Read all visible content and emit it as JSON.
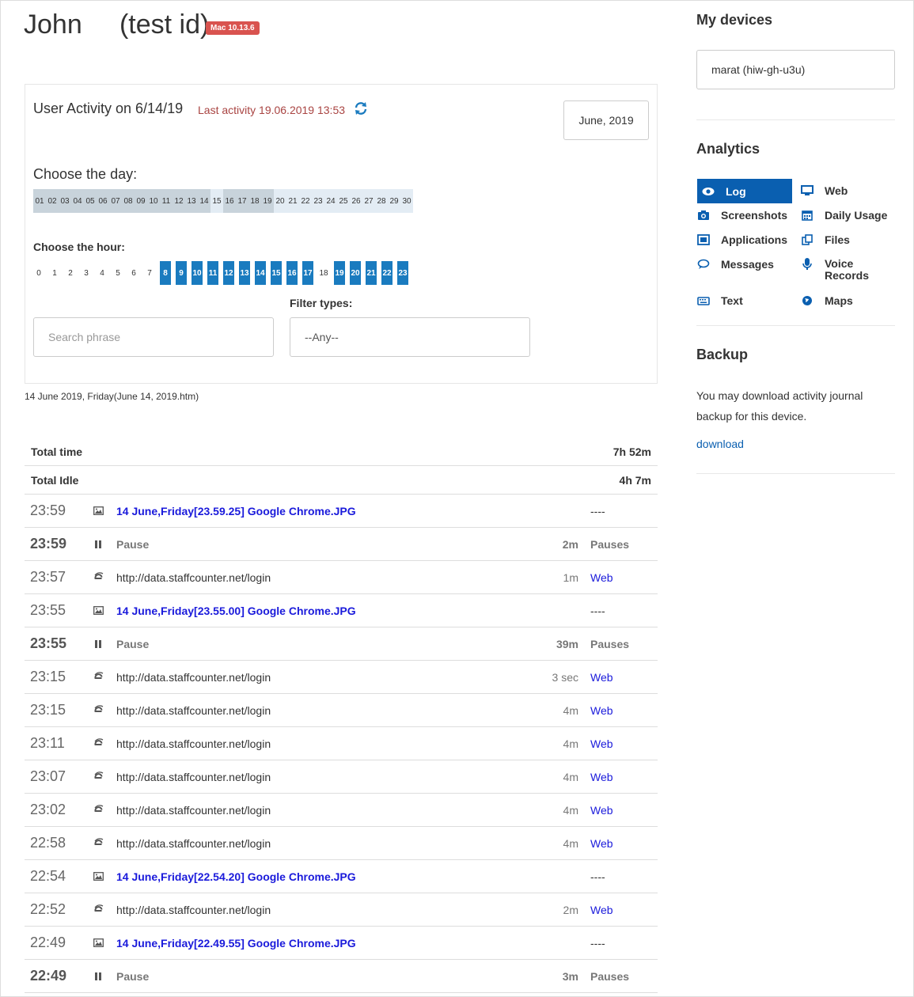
{
  "header": {
    "title": "John     (test id)",
    "os_badge": "Mac 10.13.6"
  },
  "activity": {
    "title": "User Activity on 6/14/19",
    "last_activity": "Last activity 19.06.2019 13:53",
    "month_button": "June, 2019",
    "choose_day_label": "Choose the day:",
    "days": [
      "01",
      "02",
      "03",
      "04",
      "05",
      "06",
      "07",
      "08",
      "09",
      "10",
      "11",
      "12",
      "13",
      "14",
      "15",
      "16",
      "17",
      "18",
      "19",
      "20",
      "21",
      "22",
      "23",
      "24",
      "25",
      "26",
      "27",
      "28",
      "29",
      "30"
    ],
    "choose_hour_label": "Choose the hour:",
    "hours": [
      "0",
      "1",
      "2",
      "3",
      "4",
      "5",
      "6",
      "7",
      "8",
      "9",
      "10",
      "11",
      "12",
      "13",
      "14",
      "15",
      "16",
      "17",
      "18",
      "19",
      "20",
      "21",
      "22",
      "23"
    ],
    "filter_label": "Filter types:",
    "search_placeholder": "Search phrase",
    "filter_value": "--Any--",
    "date_line": "14 June 2019, Friday(June 14, 2019.htm)"
  },
  "summary": {
    "total_time_label": "Total time",
    "total_time_value": "7h 52m",
    "total_idle_label": "Total Idle",
    "total_idle_value": "4h 7m"
  },
  "log": [
    {
      "time": "23:59",
      "kind": "screenshot",
      "desc": "14 June,Friday[23.59.25] Google Chrome.JPG",
      "dur": "",
      "type": "----"
    },
    {
      "time": "23:59",
      "kind": "pause",
      "desc": "Pause",
      "dur": "2m",
      "type": "Pauses"
    },
    {
      "time": "23:57",
      "kind": "web",
      "desc": "http://data.staffcounter.net/login",
      "dur": "1m",
      "type": "Web"
    },
    {
      "time": "23:55",
      "kind": "screenshot",
      "desc": "14 June,Friday[23.55.00] Google Chrome.JPG",
      "dur": "",
      "type": "----"
    },
    {
      "time": "23:55",
      "kind": "pause",
      "desc": "Pause",
      "dur": "39m",
      "type": "Pauses"
    },
    {
      "time": "23:15",
      "kind": "web",
      "desc": "http://data.staffcounter.net/login",
      "dur": "3 sec",
      "type": "Web"
    },
    {
      "time": "23:15",
      "kind": "web",
      "desc": "http://data.staffcounter.net/login",
      "dur": "4m",
      "type": "Web"
    },
    {
      "time": "23:11",
      "kind": "web",
      "desc": "http://data.staffcounter.net/login",
      "dur": "4m",
      "type": "Web"
    },
    {
      "time": "23:07",
      "kind": "web",
      "desc": "http://data.staffcounter.net/login",
      "dur": "4m",
      "type": "Web"
    },
    {
      "time": "23:02",
      "kind": "web",
      "desc": "http://data.staffcounter.net/login",
      "dur": "4m",
      "type": "Web"
    },
    {
      "time": "22:58",
      "kind": "web",
      "desc": "http://data.staffcounter.net/login",
      "dur": "4m",
      "type": "Web"
    },
    {
      "time": "22:54",
      "kind": "screenshot",
      "desc": "14 June,Friday[22.54.20] Google Chrome.JPG",
      "dur": "",
      "type": "----"
    },
    {
      "time": "22:52",
      "kind": "web",
      "desc": "http://data.staffcounter.net/login",
      "dur": "2m",
      "type": "Web"
    },
    {
      "time": "22:49",
      "kind": "screenshot",
      "desc": "14 June,Friday[22.49.55] Google Chrome.JPG",
      "dur": "",
      "type": "----"
    },
    {
      "time": "22:49",
      "kind": "pause",
      "desc": "Pause",
      "dur": "3m",
      "type": "Pauses"
    }
  ],
  "sidebar": {
    "devices_title": "My devices",
    "device": "marat (hiw-gh-u3u)",
    "analytics_title": "Analytics",
    "nav": {
      "log": "Log",
      "web": "Web",
      "screenshots": "Screenshots",
      "daily_usage": "Daily Usage",
      "applications": "Applications",
      "files": "Files",
      "messages": "Messages",
      "voice_records": "Voice Records",
      "text": "Text",
      "maps": "Maps"
    },
    "backup_title": "Backup",
    "backup_text": "You may download activity journal backup for this device.",
    "download_link": "download"
  },
  "colors": {
    "accent": "#0a5fb0",
    "hour_active": "#1a7bbf",
    "badge": "#d9534f",
    "last_activity": "#a94442",
    "link": "#1a1adb"
  }
}
